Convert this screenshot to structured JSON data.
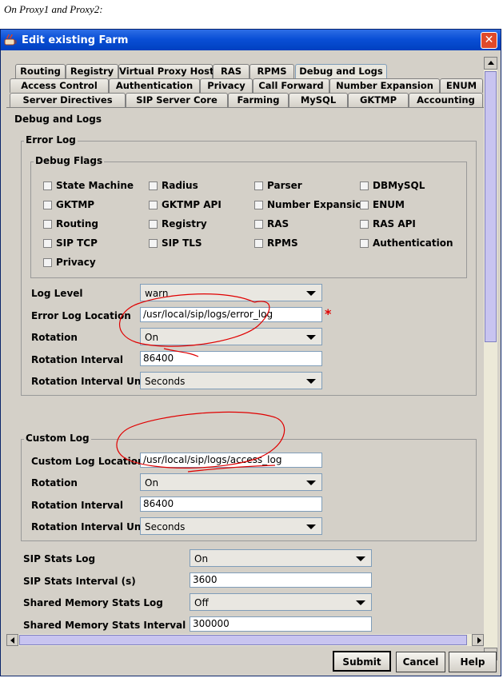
{
  "caption": "On Proxy1 and Proxy2:",
  "window": {
    "title": "Edit existing Farm"
  },
  "tabs": {
    "row1": [
      "Routing",
      "Registry",
      "Virtual Proxy Host",
      "RAS",
      "RPMS",
      "Debug and Logs"
    ],
    "row2": [
      "Access Control",
      "Authentication",
      "Privacy",
      "Call Forward",
      "Number Expansion",
      "ENUM"
    ],
    "row3": [
      "Server Directives",
      "SIP Server Core",
      "Farming",
      "MySQL",
      "GKTMP",
      "Accounting"
    ],
    "active": "Debug and Logs"
  },
  "panel_title": "Debug and Logs",
  "error_log": {
    "legend": "Error Log",
    "debug_flags": {
      "legend": "Debug Flags",
      "items": [
        "State Machine",
        "Radius",
        "Parser",
        "DBMySQL",
        "GKTMP",
        "GKTMP API",
        "Number Expansion",
        "ENUM",
        "Routing",
        "Registry",
        "RAS",
        "RAS API",
        "SIP TCP",
        "SIP TLS",
        "RPMS",
        "Authentication",
        "Privacy"
      ]
    },
    "log_level_label": "Log Level",
    "log_level_value": "warn",
    "location_label": "Error Log Location",
    "location_value": "/usr/local/sip/logs/error_log",
    "required_marker": "*",
    "rotation_label": "Rotation",
    "rotation_value": "On",
    "interval_label": "Rotation Interval",
    "interval_value": "86400",
    "units_label": "Rotation Interval Units",
    "units_value": "Seconds"
  },
  "custom_log": {
    "legend": "Custom Log",
    "location_label": "Custom Log Location",
    "location_value": "/usr/local/sip/logs/access_log",
    "rotation_label": "Rotation",
    "rotation_value": "On",
    "interval_label": "Rotation Interval",
    "interval_value": "86400",
    "units_label": "Rotation Interval Units",
    "units_value": "Seconds"
  },
  "stats": {
    "sip_stats_log_label": "SIP Stats Log",
    "sip_stats_log_value": "On",
    "sip_stats_interval_label": "SIP Stats Interval (s)",
    "sip_stats_interval_value": "3600",
    "shm_stats_log_label": "Shared Memory Stats Log",
    "shm_stats_log_value": "Off",
    "shm_stats_interval_label": "Shared Memory Stats Interval (ms)",
    "shm_stats_interval_value": "300000"
  },
  "buttons": {
    "submit": "Submit",
    "cancel": "Cancel",
    "help": "Help"
  },
  "colors": {
    "titlebar": "#0a4fd6",
    "annotation": "#e00000",
    "dialog": "#d4d0c8"
  }
}
